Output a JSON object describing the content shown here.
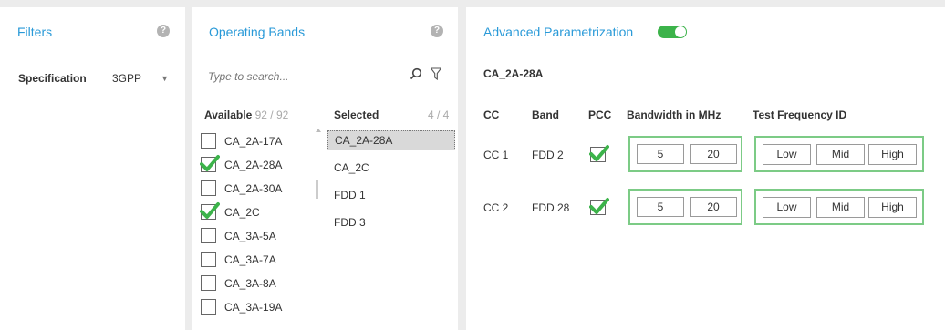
{
  "filters": {
    "title": "Filters",
    "help": "?",
    "spec_label": "Specification",
    "spec_value": "3GPP"
  },
  "bands": {
    "title": "Operating Bands",
    "help": "?",
    "search_placeholder": "Type to search...",
    "available_label": "Available",
    "available_count": "92 / 92",
    "selected_label": "Selected",
    "selected_count": "4 / 4",
    "available_items": [
      {
        "label": "CA_2A-17A",
        "checked": false
      },
      {
        "label": "CA_2A-28A",
        "checked": true
      },
      {
        "label": "CA_2A-30A",
        "checked": false
      },
      {
        "label": "CA_2C",
        "checked": true
      },
      {
        "label": "CA_3A-5A",
        "checked": false
      },
      {
        "label": "CA_3A-7A",
        "checked": false
      },
      {
        "label": "CA_3A-8A",
        "checked": false
      },
      {
        "label": "CA_3A-19A",
        "checked": false
      }
    ],
    "selected_items": [
      "CA_2A-28A",
      "CA_2C",
      "FDD 1",
      "FDD 3"
    ]
  },
  "params": {
    "title": "Advanced Parametrization",
    "toggle_on": true,
    "combo_name": "CA_2A-28A",
    "columns": [
      "CC",
      "Band",
      "PCC",
      "Bandwidth in MHz",
      "Test Frequency ID"
    ],
    "rows": [
      {
        "cc": "CC 1",
        "band": "FDD 2",
        "pcc": true,
        "bw1": "5",
        "bw2": "20",
        "freq": [
          "Low",
          "Mid",
          "High"
        ]
      },
      {
        "cc": "CC 2",
        "band": "FDD 28",
        "pcc": true,
        "bw1": "5",
        "bw2": "20",
        "freq": [
          "Low",
          "Mid",
          "High"
        ]
      }
    ]
  },
  "colors": {
    "accent": "#2a9ad8",
    "check_green": "#3cb34a",
    "group_border": "#7ccb86"
  }
}
